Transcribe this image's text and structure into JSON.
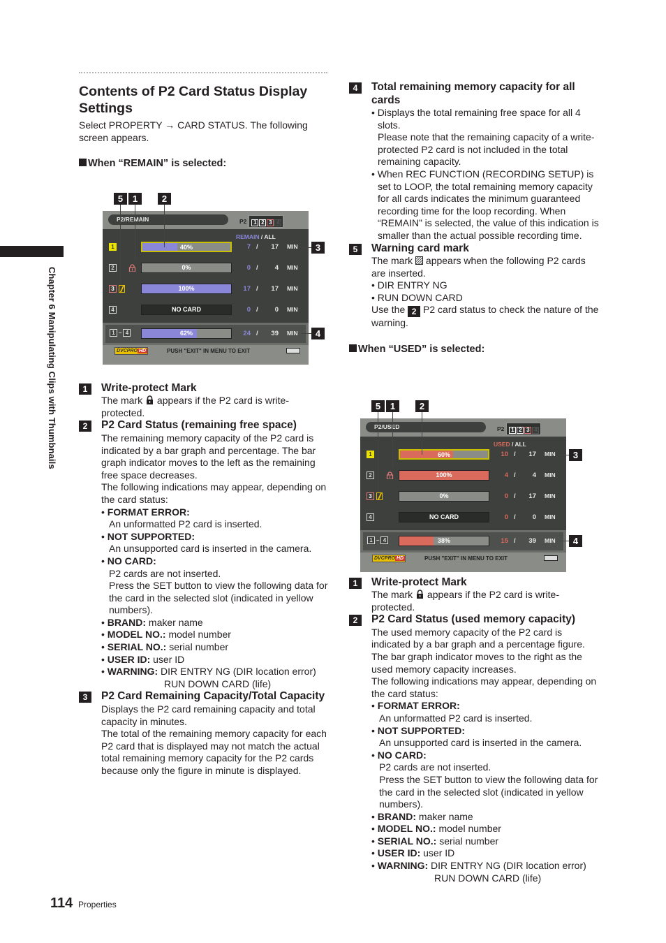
{
  "side_tab": {
    "label": "Chapter 6  Manipulating Clips with Thumbnails"
  },
  "footer": {
    "page_number": "114",
    "section": "Properties"
  },
  "left": {
    "title": "Contents of P2 Card Status Display Settings",
    "intro": "Select PROPERTY → CARD STATUS. The following screen appears.",
    "remain_heading": "When “REMAIN” is selected:",
    "items": [
      {
        "num": "1",
        "title": "Write-protect Mark",
        "text_before": "The mark ",
        "text_after": " appears if the P2 card is write-protected."
      },
      {
        "num": "2",
        "title": "P2 Card Status (remaining free space)",
        "text": "The remaining memory capacity of the P2 card is indicated by a bar graph and percentage. The bar graph indicator moves to the left as the remaining free space decreases.",
        "text2": "The following indications may appear, depending on the card status:",
        "bullets": [
          {
            "label": "FORMAT ERROR:",
            "desc": "An unformatted P2 card is inserted."
          },
          {
            "label": "NOT SUPPORTED:",
            "desc": "An unsupported card is inserted in the camera."
          },
          {
            "label": "NO CARD:",
            "desc": "P2 cards are not inserted.",
            "desc2": "Press the SET button to view the following data for the card in the selected slot (indicated in yellow numbers)."
          }
        ],
        "fields": [
          {
            "label": "BRAND:",
            "value": "maker name"
          },
          {
            "label": "MODEL NO.:",
            "value": "model number"
          },
          {
            "label": "SERIAL NO.:",
            "value": "serial number"
          },
          {
            "label": "USER ID:",
            "value": "user ID"
          },
          {
            "label": "WARNING:",
            "value": "DIR ENTRY NG (DIR location error)",
            "value2": "RUN DOWN CARD (life)"
          }
        ]
      },
      {
        "num": "3",
        "title": "P2 Card Remaining Capacity/Total Capacity",
        "text": "Displays the P2 card remaining capacity and total capacity in minutes.",
        "text2": "The total of the remaining memory capacity for each P2 card that is displayed may not match the actual total remaining memory capacity for the P2 cards because only the figure in minute is displayed."
      }
    ]
  },
  "right": {
    "items_top": [
      {
        "num": "4",
        "title": "Total remaining memory capacity for all cards",
        "bullet1": "Displays the total remaining free space for all 4 slots.",
        "bullet1b": "Please note that the remaining capacity of a write-protected P2 card is not included in the total remaining capacity.",
        "bullet2": "When REC FUNCTION (RECORDING SETUP) is set to LOOP, the total remaining memory capacity for all cards indicates the minimum guaranteed recording time for the loop recording. When “REMAIN” is selected, the value of this indication is smaller than the actual possible recording time."
      },
      {
        "num": "5",
        "title": "Warning card mark",
        "text_before": "The mark ",
        "text_after": " appears when the following P2 cards are inserted.",
        "bullets": [
          "DIR ENTRY NG",
          "RUN DOWN CARD"
        ],
        "use_before": "Use the ",
        "use_num": "2",
        "use_after": " P2 card status to check the nature of the warning."
      }
    ],
    "used_heading": "When “USED” is selected:",
    "items": [
      {
        "num": "1",
        "title": "Write-protect Mark",
        "text_before": "The mark ",
        "text_after": " appears if the P2 card is write-protected."
      },
      {
        "num": "2",
        "title": "P2 Card Status (used memory capacity)",
        "text": "The used memory capacity of the P2 card is indicated by a bar graph and a percentage figure. The bar graph indicator moves to the right as the used memory capacity increases.",
        "text2": "The following indications may appear, depending on the card status:",
        "bullets": [
          {
            "label": "FORMAT ERROR:",
            "desc": "An unformatted P2 card is inserted."
          },
          {
            "label": "NOT SUPPORTED:",
            "desc": "An unsupported card is inserted in the camera."
          },
          {
            "label": "NO CARD:",
            "desc": "P2 cards are not inserted.",
            "desc2": "Press the SET button to view the following data for the card in the selected slot (indicated in yellow numbers)."
          }
        ],
        "fields": [
          {
            "label": "BRAND:",
            "value": "maker name"
          },
          {
            "label": "MODEL NO.:",
            "value": "model number"
          },
          {
            "label": "SERIAL NO.:",
            "value": "serial number"
          },
          {
            "label": "USER ID:",
            "value": "user ID"
          },
          {
            "label": "WARNING:",
            "value": "DIR ENTRY NG (DIR location error)",
            "value2": "RUN DOWN CARD (life)"
          }
        ]
      }
    ]
  },
  "screens": {
    "remain": {
      "title": "P2/REMAIN",
      "slots_label": "P2",
      "slots": [
        "1",
        "2",
        "3",
        "4"
      ],
      "header_a": "REMAIN",
      "header_sep": " / ",
      "header_b": "ALL",
      "accent": "#8b87d8",
      "callouts": [
        "5",
        "1",
        "2",
        "3",
        "4"
      ],
      "rows": [
        {
          "slot": "1",
          "bar_text": "40%",
          "fill": 0.4,
          "a": "7",
          "b": "17",
          "unit": "MIN"
        },
        {
          "slot": "2",
          "bar_text": "0%",
          "fill": 0,
          "a": "0",
          "b": "4",
          "unit": "MIN"
        },
        {
          "slot": "3",
          "bar_text": "100%",
          "fill": 1.0,
          "a": "17",
          "b": "17",
          "unit": "MIN"
        },
        {
          "slot": "4",
          "bar_text": "NO CARD",
          "fill": 0,
          "a": "0",
          "b": "0",
          "unit": "MIN"
        }
      ],
      "total": {
        "from": "1",
        "dash": "–",
        "to": "4",
        "bar_text": "62%",
        "fill": 0.62,
        "a": "24",
        "b": "39",
        "unit": "MIN"
      },
      "logo": "DVCPRO",
      "logo_hd": "HD",
      "footer_text": "PUSH \"EXIT\" IN MENU TO EXIT"
    },
    "used": {
      "title": "P2/USED",
      "slots_label": "P2",
      "slots": [
        "1",
        "2",
        "3",
        "4"
      ],
      "header_a": "USED",
      "header_sep": " / ",
      "header_b": "ALL",
      "accent": "#d96a5c",
      "callouts": [
        "5",
        "1",
        "2",
        "3",
        "4"
      ],
      "rows": [
        {
          "slot": "1",
          "bar_text": "60%",
          "fill": 0.6,
          "a": "10",
          "b": "17",
          "unit": "MIN"
        },
        {
          "slot": "2",
          "bar_text": "100%",
          "fill": 1.0,
          "a": "4",
          "b": "4",
          "unit": "MIN"
        },
        {
          "slot": "3",
          "bar_text": "0%",
          "fill": 0,
          "a": "0",
          "b": "17",
          "unit": "MIN"
        },
        {
          "slot": "4",
          "bar_text": "NO CARD",
          "fill": 0,
          "a": "0",
          "b": "0",
          "unit": "MIN"
        }
      ],
      "total": {
        "from": "1",
        "dash": "–",
        "to": "4",
        "bar_text": "38%",
        "fill": 0.38,
        "a": "15",
        "b": "39",
        "unit": "MIN"
      },
      "logo": "DVCPRO",
      "logo_hd": "HD",
      "footer_text": "PUSH \"EXIT\" IN MENU TO EXIT"
    }
  }
}
